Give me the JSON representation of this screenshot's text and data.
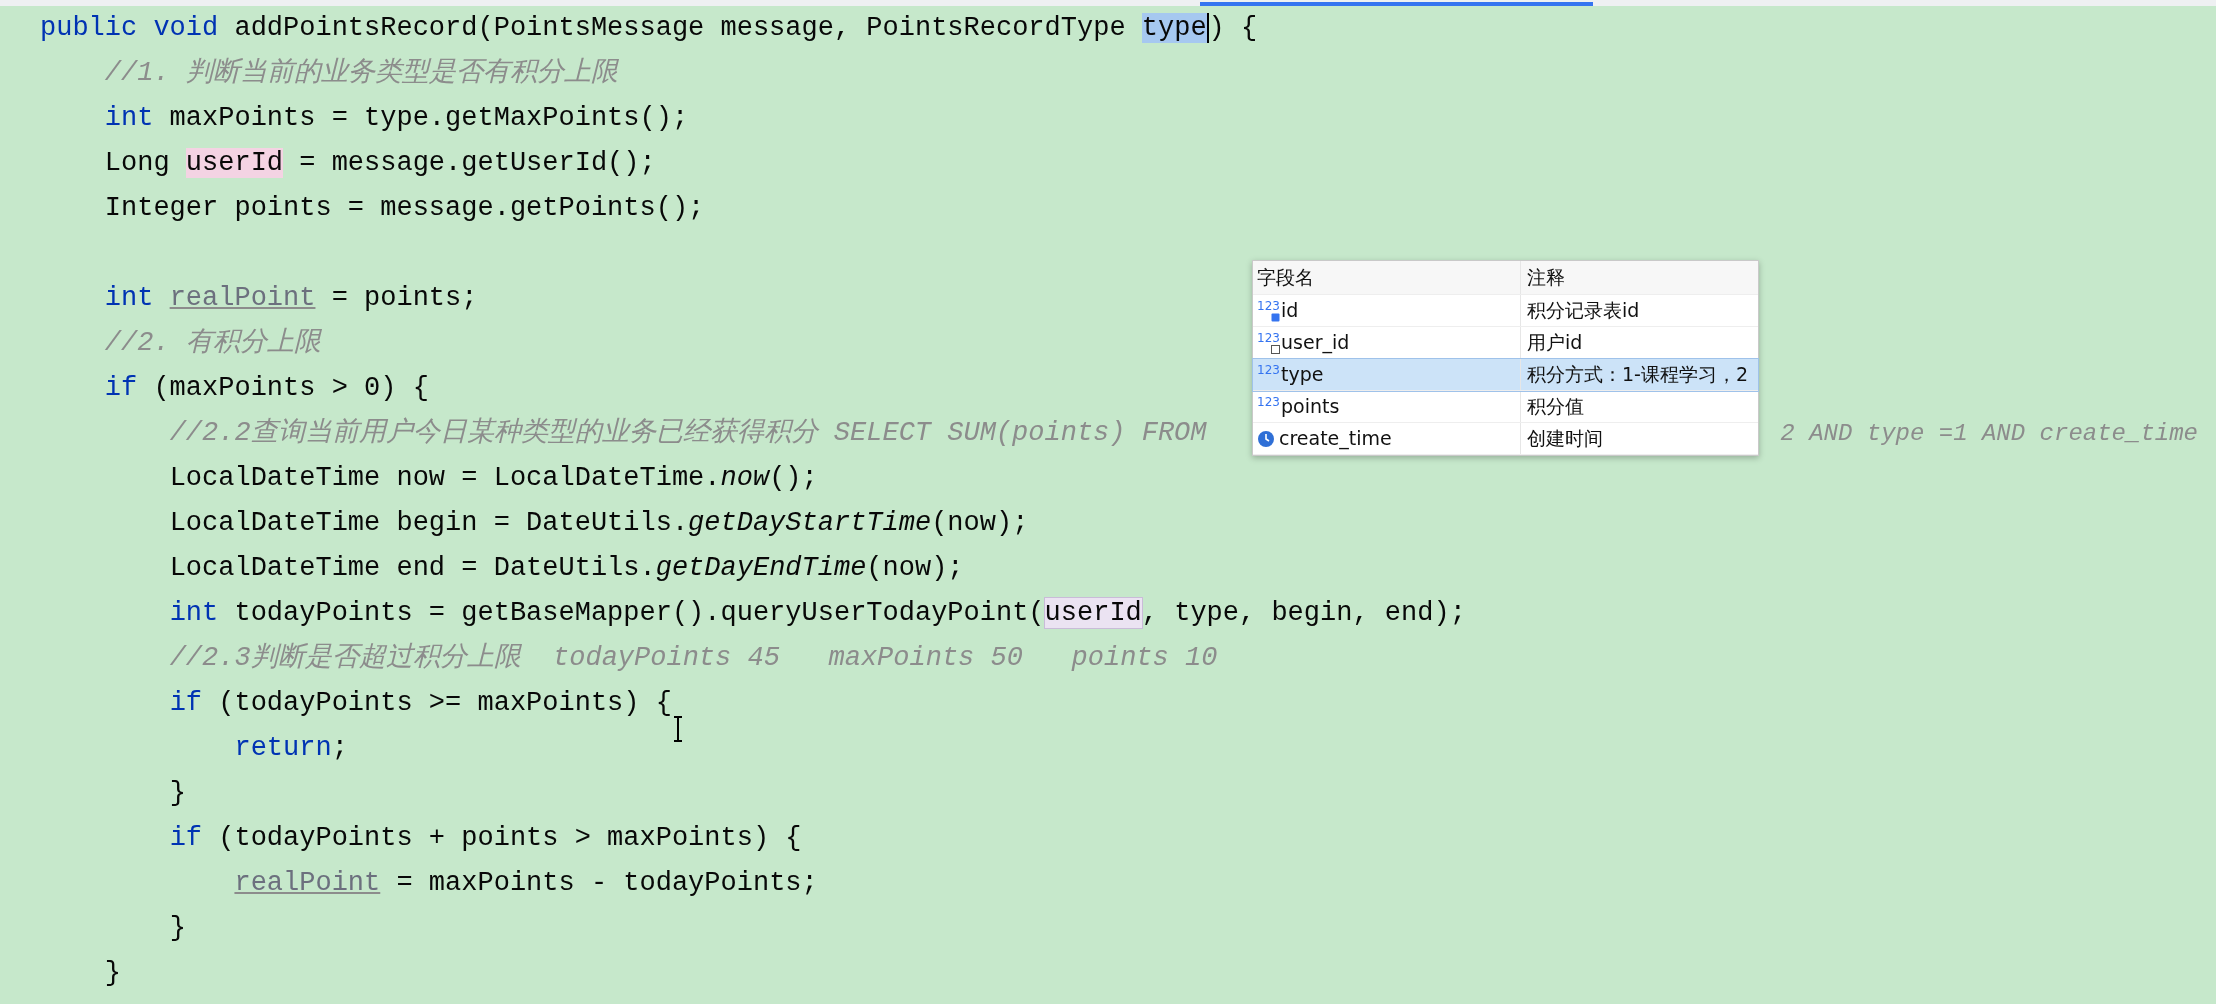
{
  "editor": {
    "lines": [
      {
        "kind": "code",
        "tokens": [
          {
            "text": "public void",
            "kind": "keyword"
          },
          {
            "text": " addPointsRecord(PointsMessage message, PointsRecordType ",
            "kind": "plain"
          },
          {
            "text": "type",
            "kind": "selection"
          },
          {
            "text": ") {",
            "kind": "plain"
          }
        ]
      },
      {
        "kind": "code",
        "tokens": [
          {
            "text": "    //1. 判断当前的业务类型是否有积分上限",
            "kind": "comment"
          }
        ]
      },
      {
        "kind": "code",
        "tokens": [
          {
            "text": "    int",
            "kind": "keyword"
          },
          {
            "text": " maxPoints = type.getMaxPoints();",
            "kind": "plain"
          }
        ]
      },
      {
        "kind": "code",
        "tokens": [
          {
            "text": "    Long ",
            "kind": "plain"
          },
          {
            "text": "userId",
            "kind": "write-highlight"
          },
          {
            "text": " = message.getUserId();",
            "kind": "plain"
          }
        ]
      },
      {
        "kind": "code",
        "tokens": [
          {
            "text": "    Integer points = message.getPoints();",
            "kind": "plain"
          }
        ]
      },
      {
        "kind": "blank"
      },
      {
        "kind": "code",
        "tokens": [
          {
            "text": "    int ",
            "kind": "keyword"
          },
          {
            "text": "realPoint",
            "kind": "unused"
          },
          {
            "text": " = points;",
            "kind": "plain"
          }
        ]
      },
      {
        "kind": "code",
        "tokens": [
          {
            "text": "    //2. 有积分上限",
            "kind": "comment"
          }
        ]
      },
      {
        "kind": "code",
        "tokens": [
          {
            "text": "    if",
            "kind": "keyword"
          },
          {
            "text": " (maxPoints > 0) {",
            "kind": "plain"
          }
        ]
      },
      {
        "kind": "code",
        "tokens": [
          {
            "text": "        //2.2查询当前用户今日某种类型的业务已经获得积分 SELECT SUM(points) FROM",
            "kind": "comment"
          }
        ],
        "after_popup": [
          {
            "text": "2 AND type =1 AND create_time",
            "kind": "comment"
          }
        ]
      },
      {
        "kind": "code",
        "tokens": [
          {
            "text": "        LocalDateTime now = LocalDateTime.",
            "kind": "plain"
          },
          {
            "text": "now",
            "kind": "static"
          },
          {
            "text": "();",
            "kind": "plain"
          }
        ]
      },
      {
        "kind": "code",
        "tokens": [
          {
            "text": "        LocalDateTime begin = DateUtils.",
            "kind": "plain"
          },
          {
            "text": "getDayStartTime",
            "kind": "static"
          },
          {
            "text": "(now);",
            "kind": "plain"
          }
        ]
      },
      {
        "kind": "code",
        "tokens": [
          {
            "text": "        LocalDateTime end = DateUtils.",
            "kind": "plain"
          },
          {
            "text": "getDayEndTime",
            "kind": "static"
          },
          {
            "text": "(now);",
            "kind": "plain"
          }
        ]
      },
      {
        "kind": "code",
        "tokens": [
          {
            "text": "        int",
            "kind": "keyword"
          },
          {
            "text": " todayPoints = getBaseMapper().queryUserTodayPoint(",
            "kind": "plain"
          },
          {
            "text": "userId",
            "kind": "read-highlight"
          },
          {
            "text": ", type, begin, end);",
            "kind": "plain"
          }
        ]
      },
      {
        "kind": "code",
        "tokens": [
          {
            "text": "        //2.3判断是否超过积分上限  todayPoints 45   maxPoints 50   points 10",
            "kind": "comment"
          }
        ]
      },
      {
        "kind": "code",
        "tokens": [
          {
            "text": "        if",
            "kind": "keyword"
          },
          {
            "text": " (todayPoints >= maxPoints) {",
            "kind": "plain"
          }
        ]
      },
      {
        "kind": "code",
        "tokens": [
          {
            "text": "            return",
            "kind": "keyword"
          },
          {
            "text": ";",
            "kind": "plain"
          }
        ]
      },
      {
        "kind": "code",
        "tokens": [
          {
            "text": "        }",
            "kind": "plain"
          }
        ]
      },
      {
        "kind": "code",
        "tokens": [
          {
            "text": "        if",
            "kind": "keyword"
          },
          {
            "text": " (todayPoints + points > maxPoints) {",
            "kind": "plain"
          }
        ]
      },
      {
        "kind": "code",
        "tokens": [
          {
            "text": "            realPoint",
            "kind": "unused"
          },
          {
            "text": " = maxPoints - todayPoints;",
            "kind": "plain"
          }
        ]
      },
      {
        "kind": "code",
        "tokens": [
          {
            "text": "        }",
            "kind": "plain"
          }
        ]
      },
      {
        "kind": "code",
        "tokens": [
          {
            "text": "    }",
            "kind": "plain"
          }
        ]
      }
    ]
  },
  "field_popup": {
    "columns": [
      "字段名",
      "注释"
    ],
    "rows": [
      {
        "kind": "primary-key",
        "type_label": "123",
        "name": "id",
        "comment": "积分记录表id",
        "selected": false
      },
      {
        "kind": "index",
        "type_label": "123",
        "name": "user_id",
        "comment": "用户id",
        "selected": false
      },
      {
        "kind": "number",
        "type_label": "123",
        "name": "type",
        "comment": "积分方式：1-课程学习，2",
        "selected": true
      },
      {
        "kind": "number",
        "type_label": "123",
        "name": "points",
        "comment": "积分值",
        "selected": false
      },
      {
        "kind": "datetime",
        "name": "create_time",
        "comment": "创建时间",
        "selected": false
      }
    ]
  }
}
